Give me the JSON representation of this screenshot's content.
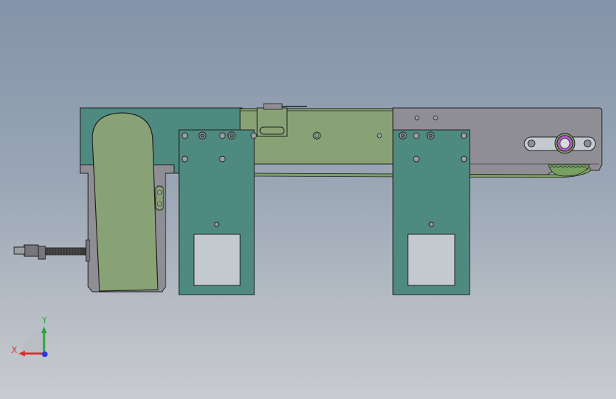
{
  "viewport": {
    "background_top": "#8393a9",
    "background_bottom": "#c9ccd0"
  },
  "colors": {
    "teal_plate": "#4e8a80",
    "teal_plate_dark": "#3f7a70",
    "olive_panel": "#88a276",
    "grey_rail": "#8f8e95",
    "grey_housing": "#77767d",
    "edge": "#1e1e1e",
    "hole_fill": "#9aa0a0",
    "purple_bearing": "#b45fc8",
    "belt_green": "#78a060",
    "window_fill": "#c4c8cf"
  },
  "triad": {
    "x_label": "X",
    "y_label": "Y",
    "x_color": "#d93030",
    "y_color": "#2aa63a",
    "z_color": "#2b3bd6"
  }
}
